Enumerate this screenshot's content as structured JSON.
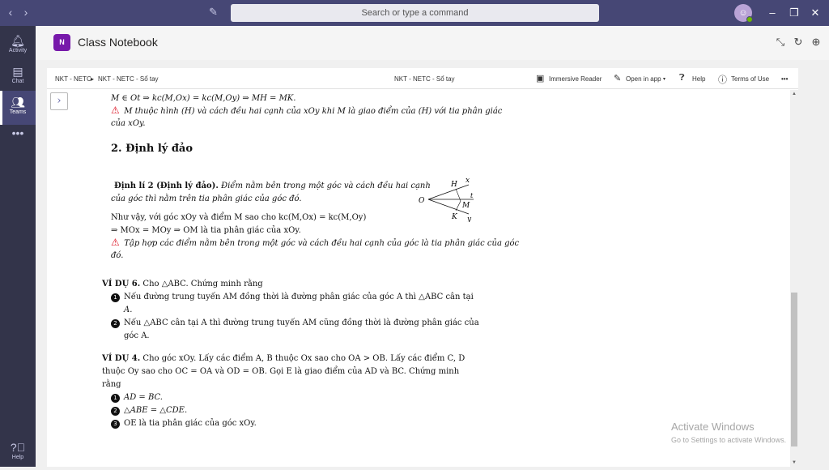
{
  "titlebar": {
    "back_icon": "chevron-left-icon",
    "forward_icon": "chevron-right-icon",
    "compose_icon": "compose-icon",
    "search_placeholder": "Search or type a command",
    "avatar_icon": "user-avatar",
    "presence_color": "#6bb700",
    "minimize_icon": "minimize-icon",
    "maximize_icon": "maximize-icon",
    "close_icon": "close-icon",
    "bg_color": "#464775"
  },
  "rail": {
    "items": [
      {
        "label": "Activity",
        "icon": "bell-icon"
      },
      {
        "label": "Chat",
        "icon": "chat-icon"
      },
      {
        "label": "Teams",
        "icon": "teams-icon"
      },
      {
        "label": "",
        "icon": "more-icon"
      }
    ],
    "help_label": "Help",
    "active": "Teams"
  },
  "app": {
    "title": "Class Notebook",
    "logo_text": "N",
    "logo_color": "#7719aa"
  },
  "toolbar": {
    "breadcrumb_1": "NKT - NETC",
    "breadcrumb_2": "NKT - NETC - Sổ tay",
    "center_title": "NKT - NETC - Sổ tay",
    "immersive_reader": "Immersive Reader",
    "open_in_app": "Open in app",
    "help": "Help",
    "terms": "Terms of Use"
  },
  "doc": {
    "top_line": "M ∈ Ot ⇒ kc(M,Ox) = kc(M,Oy) ⇒ MH = MK.",
    "note1_a": "M thuộc hình (H) và cách đều hai cạnh của xOy khi M là giao điểm của (H) với tia phân giác",
    "note1_b": "của xOy.",
    "section_title": "2. Định lý đảo",
    "theorem_label": "Định lí 2 (Định lý đảo).",
    "theorem_a": "Điểm nằm bên trong một góc và cách đều hai cạnh",
    "theorem_b": "của góc thì nằm trên tia phân giác của góc đó.",
    "para_a": "Như vậy, với góc xOy và điểm M sao cho kc(M,Ox) = kc(M,Oy)",
    "para_b": "⇒ MOx = MOy ⇒ OM là tia phân giác của xOy.",
    "note2_a": "Tập hợp các điểm nằm bên trong một góc và cách đều hai cạnh của góc là tia phân giác của góc",
    "note2_b": "đó.",
    "ex6_label": "VÍ DỤ 6.",
    "ex6_text": "Cho △ABC. Chứng minh rằng",
    "ex6_items": [
      {
        "num": "1",
        "line1": "Nếu đường trung tuyến AM đồng thời là đường phân giác của góc A thì △ABC cân tại",
        "line2": "A."
      },
      {
        "num": "2",
        "line1": "Nếu △ABC cân tại A thì đường trung tuyến AM cũng đồng thời là đường phân giác của",
        "line2": "góc A."
      }
    ],
    "ex4_label": "VÍ DỤ 4.",
    "ex4_a": "Cho góc xOy. Lấy các điểm A, B thuộc Ox sao cho OA > OB. Lấy các điểm C, D",
    "ex4_b": "thuộc Oy sao cho OC = OA và OD = OB. Gọi E là giao điểm của AD và BC. Chứng minh",
    "ex4_c": "rằng",
    "ex4_items": [
      {
        "num": "1",
        "text": "AD = BC."
      },
      {
        "num": "2",
        "text": "△ABE = △CDE."
      },
      {
        "num": "3",
        "text": "OE là tia phân giác của góc xOy."
      }
    ],
    "figure_labels": {
      "O": "O",
      "H": "H",
      "x": "x",
      "t": "t",
      "M": "M",
      "K": "K",
      "y": "y"
    }
  },
  "watermark": {
    "line1": "Activate Windows",
    "line2": "Go to Settings to activate Windows."
  }
}
